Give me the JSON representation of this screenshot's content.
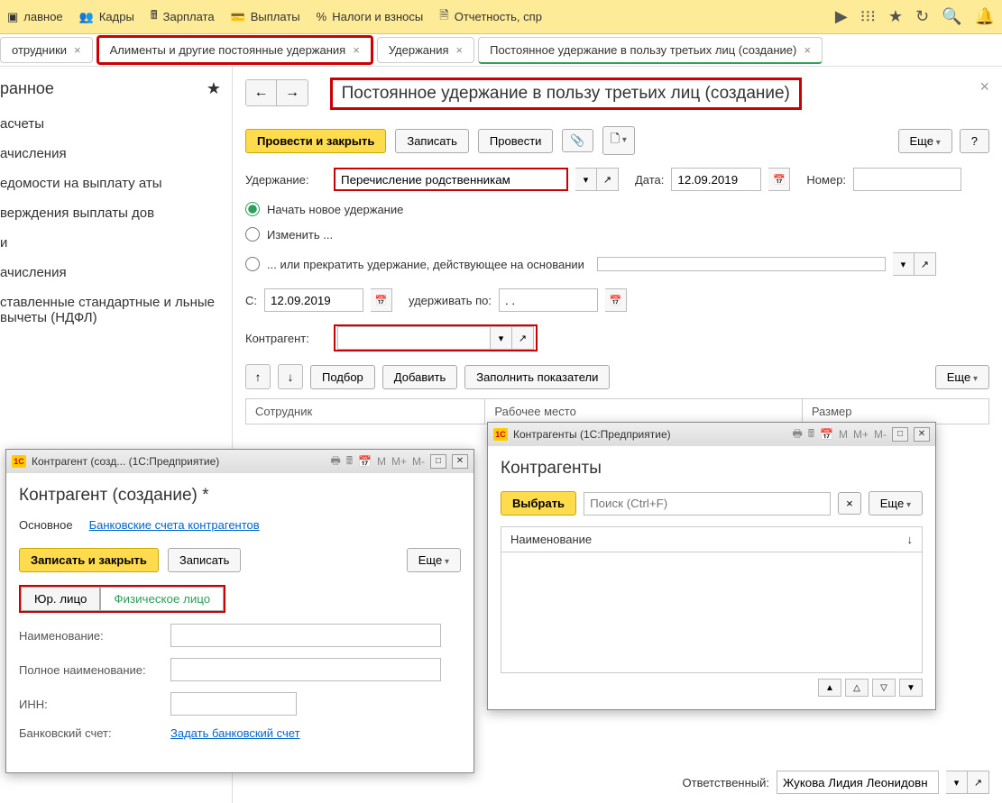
{
  "toolbar": {
    "items": [
      "лавное",
      "Кадры",
      "Зарплата",
      "Выплаты",
      "Налоги и взносы",
      "Отчетность, спр"
    ]
  },
  "tabs": [
    {
      "label": "отрудники"
    },
    {
      "label": "Алименты и другие постоянные удержания"
    },
    {
      "label": "Удержания"
    },
    {
      "label": "Постоянное удержание в пользу третьих лиц (создание)"
    }
  ],
  "sidebar": {
    "header": "ранное",
    "items": [
      "асчеты",
      "ачисления",
      "едомости на выплату аты",
      "верждения выплаты дов",
      "и",
      "ачисления",
      "ставленные стандартные и льные вычеты (НДФЛ)"
    ]
  },
  "page": {
    "title": "Постоянное удержание в пользу третьих лиц (создание)",
    "actions": {
      "main": "Провести и закрыть",
      "save": "Записать",
      "post": "Провести",
      "more": "Еще"
    },
    "form": {
      "uderzh_label": "Удержание:",
      "uderzh_value": "Перечисление родственникам",
      "date_label": "Дата:",
      "date_value": "12.09.2019",
      "number_label": "Номер:",
      "radio1": "Начать новое удержание",
      "radio2": "Изменить ...",
      "radio3": "... или прекратить удержание, действующее на основании",
      "from_label": "С:",
      "from_value": "12.09.2019",
      "until_label": "удерживать по:",
      "until_value": ". . ",
      "counterparty_label": "Контрагент:"
    },
    "table": {
      "toolbar": {
        "pick": "Подбор",
        "add": "Добавить",
        "fill": "Заполнить показатели",
        "more": "Еще"
      },
      "cols": [
        "Сотрудник",
        "Рабочее место",
        "Размер"
      ]
    },
    "footer": {
      "resp_label": "Ответственный:",
      "resp_value": "Жукова Лидия Леонидовн"
    }
  },
  "dialog1": {
    "titlebar": "Контрагент (созд...  (1С:Предприятие)",
    "title": "Контрагент (создание) *",
    "tabs": {
      "main": "Основное",
      "bank": "Банковские счета контрагентов"
    },
    "actions": {
      "main": "Записать и закрыть",
      "save": "Записать",
      "more": "Еще"
    },
    "seg": {
      "legal": "Юр. лицо",
      "person": "Физическое лицо"
    },
    "fields": {
      "name": "Наименование:",
      "fullname": "Полное наименование:",
      "inn": "ИНН:",
      "bank": "Банковский счет:",
      "bank_link": "Задать банковский счет"
    }
  },
  "dialog2": {
    "titlebar": "Контрагенты (1С:Предприятие)",
    "title": "Контрагенты",
    "select": "Выбрать",
    "search_ph": "Поиск (Ctrl+F)",
    "more": "Еще",
    "col": "Наименование"
  }
}
